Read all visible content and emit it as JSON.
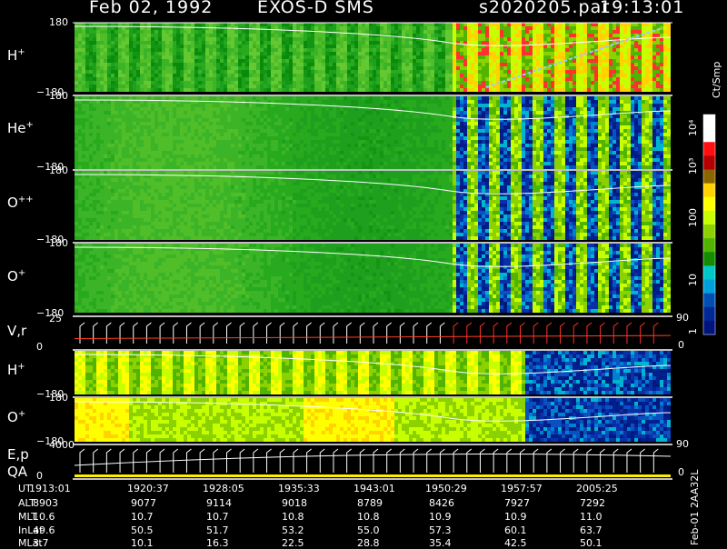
{
  "header": {
    "date": "Feb 02, 1992",
    "mission": "EXOS-D SMS",
    "file": "s2020205.par",
    "time": "19:13:01"
  },
  "panels": [
    {
      "species": "H",
      "charge": "+",
      "ymax": "180",
      "ymin": "−180"
    },
    {
      "species": "He",
      "charge": "+",
      "ymax": "180",
      "ymin": "−180"
    },
    {
      "species": "O",
      "charge": "++",
      "ymax": "180",
      "ymin": "−180"
    },
    {
      "species": "O",
      "charge": "+",
      "ymax": "180",
      "ymin": "−180"
    },
    {
      "species": "V,r",
      "charge": "",
      "ymax": "25",
      "ymin": "0"
    },
    {
      "species": "H",
      "charge": "+",
      "ymax": "",
      "ymin": "−180"
    },
    {
      "species": "O",
      "charge": "+",
      "ymax": "180",
      "ymin": "−180"
    },
    {
      "species": "E,p",
      "charge": "",
      "ymax": "4000",
      "ymin": "0",
      "sublabel": "QA"
    }
  ],
  "right_ticks": {
    "vr_top": "90",
    "vr_bottom": "0",
    "ep_top": "90",
    "ep_bottom": "0"
  },
  "colorbar": {
    "unit": "Ct/Smp",
    "ticks": [
      "10⁴",
      "10³",
      "100",
      "10",
      "1"
    ],
    "colors": [
      "#ffffff",
      "#ffffff",
      "#ff1010",
      "#b40000",
      "#8c6400",
      "#ffd200",
      "#ffff00",
      "#c8ff00",
      "#8cd200",
      "#50b400",
      "#148c00",
      "#00c8c8",
      "#00a0dc",
      "#0050b4",
      "#002896",
      "#00147d"
    ]
  },
  "time_axis": {
    "rows": [
      {
        "name": "UT",
        "values": [
          "1913:01",
          "1920:37",
          "1928:05",
          "1935:33",
          "1943:01",
          "1950:29",
          "1957:57",
          "2005:25"
        ]
      },
      {
        "name": "ALT",
        "values": [
          "8903",
          "9077",
          "9114",
          "9018",
          "8789",
          "8426",
          "7927",
          "7292"
        ]
      },
      {
        "name": "MLT",
        "values": [
          "10.6",
          "10.7",
          "10.7",
          "10.8",
          "10.8",
          "10.9",
          "10.9",
          "11.0"
        ]
      },
      {
        "name": "InLat",
        "values": [
          "49.6",
          "50.5",
          "51.7",
          "53.2",
          "55.0",
          "57.3",
          "60.1",
          "63.7"
        ]
      },
      {
        "name": "MLat",
        "values": [
          "3.7",
          "10.1",
          "16.3",
          "22.5",
          "28.8",
          "35.4",
          "42.5",
          "50.1"
        ]
      }
    ]
  },
  "side_note": "Feb-01 2AA32L",
  "chart_data": {
    "type": "heatmap",
    "title": "Feb 02, 1992   EXOS-D SMS",
    "x_ticks": [
      "1913:01",
      "1920:37",
      "1928:05",
      "1935:33",
      "1943:01",
      "1950:29",
      "1957:57",
      "2005:25"
    ],
    "panels": [
      {
        "label": "H+",
        "ylim": [
          -180,
          180
        ],
        "regime_change_at": "1950:29"
      },
      {
        "label": "He+",
        "ylim": [
          -180,
          180
        ],
        "regime_change_at": "1950:29"
      },
      {
        "label": "O++",
        "ylim": [
          -180,
          180
        ],
        "regime_change_at": "1950:29"
      },
      {
        "label": "O+",
        "ylim": [
          -180,
          180
        ],
        "regime_change_at": "1950:29"
      },
      {
        "label": "V,r",
        "ylim": [
          0,
          25
        ],
        "right_ylim": [
          0,
          90
        ]
      },
      {
        "label": "H+",
        "ylim": [
          -180,
          180
        ]
      },
      {
        "label": "O+",
        "ylim": [
          -180,
          180
        ]
      },
      {
        "label": "E,p",
        "ylim": [
          0,
          4000
        ],
        "right_ylim": [
          0,
          90
        ]
      }
    ],
    "colorbar_label": "Ct/Smp",
    "colorbar_ticks": [
      "1",
      "10",
      "100",
      "10³",
      "10⁴"
    ]
  }
}
